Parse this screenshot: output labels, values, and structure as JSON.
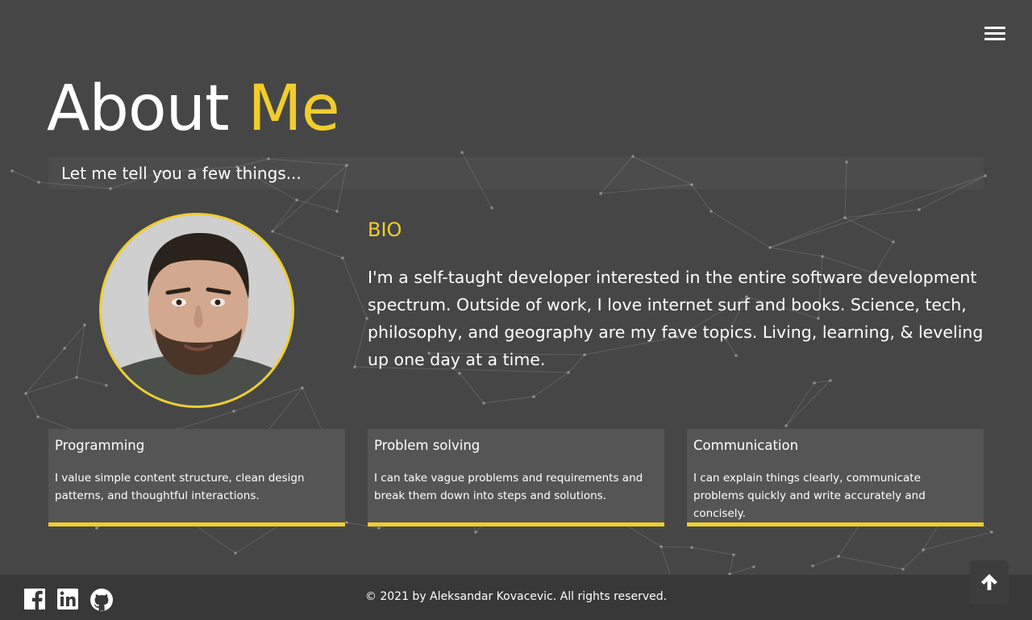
{
  "nav": {
    "menu_icon": "hamburger-menu-icon"
  },
  "header": {
    "title_main": "About",
    "title_accent": "Me",
    "subtitle": "Let me tell you a few things..."
  },
  "bio": {
    "heading": "BIO",
    "text": "I'm a self-taught developer interested in the entire software development spectrum. Outside of work, I love internet surf and books. Science, tech, philosophy, and geography are my fave topics. Living, learning, & leveling up one day at a time."
  },
  "skills": [
    {
      "title": "Programming",
      "description": "I value simple content structure, clean design patterns, and thoughtful interactions."
    },
    {
      "title": "Problem solving",
      "description": "I can take vague problems and requirements and break them down into steps and solutions."
    },
    {
      "title": "Communication",
      "description": "I can explain things clearly, communicate problems quickly and write accurately and concisely."
    }
  ],
  "footer": {
    "copyright": "© 2021 by Aleksandar Kovacevic. All rights reserved.",
    "social_icons": [
      "facebook-icon",
      "linkedin-icon",
      "github-icon"
    ],
    "scroll_top_icon": "arrow-up-icon"
  },
  "colors": {
    "background": "#464646",
    "accent": "#f0cd2e",
    "card": "#555555",
    "footer": "#383838"
  }
}
